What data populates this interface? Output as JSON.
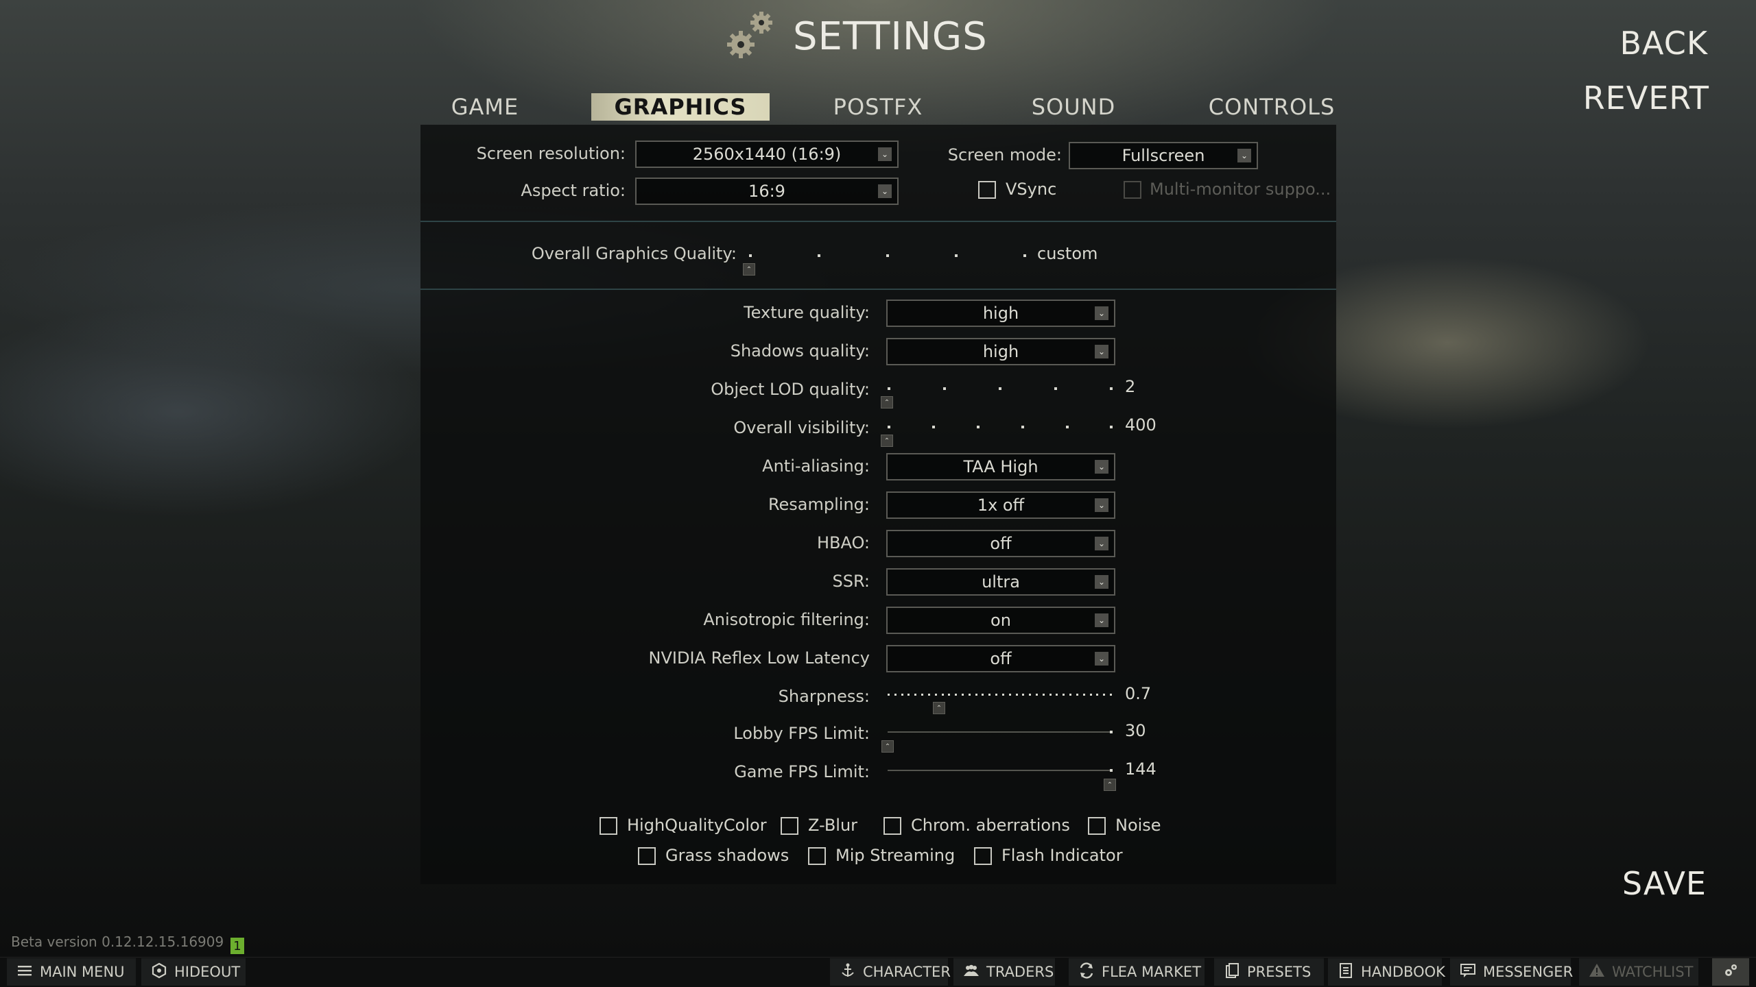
{
  "header": {
    "title": "SETTINGS",
    "back_label": "BACK",
    "revert_label": "REVERT",
    "save_label": "SAVE"
  },
  "tabs": [
    {
      "label": "GAME",
      "active": false
    },
    {
      "label": "GRAPHICS",
      "active": true
    },
    {
      "label": "POSTFX",
      "active": false
    },
    {
      "label": "SOUND",
      "active": false
    },
    {
      "label": "CONTROLS",
      "active": false
    }
  ],
  "display": {
    "screen_resolution_label": "Screen resolution:",
    "screen_resolution_value": "2560x1440 (16:9)",
    "aspect_ratio_label": "Aspect ratio:",
    "aspect_ratio_value": "16:9",
    "screen_mode_label": "Screen mode:",
    "screen_mode_value": "Fullscreen",
    "vsync_label": "VSync",
    "vsync_checked": false,
    "multimonitor_label": "Multi-monitor suppo...",
    "multimonitor_enabled": false
  },
  "overall_quality": {
    "label": "Overall Graphics Quality:",
    "value": "custom",
    "steps": 5,
    "selected_index": 0
  },
  "settings": {
    "texture_quality": {
      "label": "Texture quality:",
      "value": "high"
    },
    "shadows_quality": {
      "label": "Shadows quality:",
      "value": "high"
    },
    "object_lod": {
      "label": "Object LOD quality:",
      "value": "2",
      "steps": 5,
      "selected_index": 0
    },
    "overall_visibility": {
      "label": "Overall visibility:",
      "value": "400",
      "steps": 6,
      "selected_index": 0
    },
    "anti_aliasing": {
      "label": "Anti-aliasing:",
      "value": "TAA High"
    },
    "resampling": {
      "label": "Resampling:",
      "value": "1x off"
    },
    "hbao": {
      "label": "HBAO:",
      "value": "off"
    },
    "ssr": {
      "label": "SSR:",
      "value": "ultra"
    },
    "anisotropic": {
      "label": "Anisotropic filtering:",
      "value": "on"
    },
    "nvidia_reflex": {
      "label": "NVIDIA Reflex Low Latency",
      "value": "off"
    },
    "sharpness": {
      "label": "Sharpness:",
      "value": "0.7",
      "position": 0.23
    },
    "lobby_fps": {
      "label": "Lobby FPS Limit:",
      "value": "30",
      "position": 0.0
    },
    "game_fps": {
      "label": "Game FPS Limit:",
      "value": "144",
      "position": 1.0
    }
  },
  "checkboxes": {
    "high_quality_color": {
      "label": "HighQualityColor",
      "checked": false
    },
    "z_blur": {
      "label": "Z-Blur",
      "checked": false
    },
    "chrom_aberrations": {
      "label": "Chrom. aberrations",
      "checked": false
    },
    "noise": {
      "label": "Noise",
      "checked": false
    },
    "grass_shadows": {
      "label": "Grass shadows",
      "checked": false
    },
    "mip_streaming": {
      "label": "Mip Streaming",
      "checked": false
    },
    "flash_indicator": {
      "label": "Flash Indicator",
      "checked": false
    }
  },
  "footer": {
    "version": "Beta version 0.12.12.15.16909",
    "notification_count": "1",
    "nav": {
      "main_menu": "MAIN MENU",
      "hideout": "HIDEOUT",
      "character": "CHARACTER",
      "traders": "TRADERS",
      "flea_market": "FLEA MARKET",
      "presets": "PRESETS",
      "handbook": "HANDBOOK",
      "messenger": "MESSENGER",
      "watchlist": "WATCHLIST"
    },
    "icons": [
      "menu-icon",
      "hideout-icon",
      "character-icon",
      "traders-icon",
      "flea-market-icon",
      "presets-icon",
      "handbook-icon",
      "messenger-icon",
      "watchlist-icon",
      "settings-icon"
    ]
  },
  "colors": {
    "accent_tab": "#d9d6b8",
    "notification": "#6cae2e",
    "separator": "#2e4446"
  }
}
